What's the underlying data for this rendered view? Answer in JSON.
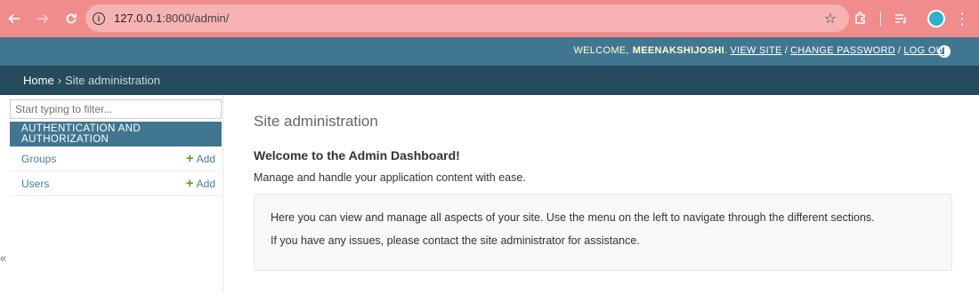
{
  "browser": {
    "url_host": "127.0.0.1",
    "url_rest": ":8000/admin/"
  },
  "header": {
    "welcome": "WELCOME,",
    "username": "MEENAKSHIJOSHI",
    "view_site": "VIEW SITE",
    "change_password": "CHANGE PASSWORD",
    "logout": "LOG OUT",
    "slash": "/"
  },
  "breadcrumbs": {
    "home": "Home",
    "separator": "›",
    "current": "Site administration"
  },
  "sidebar": {
    "filter_placeholder": "Start typing to filter...",
    "module_caption": "AUTHENTICATION AND AUTHORIZATION",
    "models": [
      {
        "name": "Groups",
        "add": "Add"
      },
      {
        "name": "Users",
        "add": "Add"
      }
    ],
    "collapse_symbol": "«"
  },
  "content": {
    "title": "Site administration",
    "welcome_heading": "Welcome to the Admin Dashboard!",
    "welcome_sub": "Manage and handle your application content with ease.",
    "info_line1": "Here you can view and manage all aspects of your site. Use the menu on the left to navigate through the different sections.",
    "info_line2": "If you have any issues, please contact the site administrator for assistance."
  },
  "colors": {
    "browser_bar": "#f08c8c",
    "header_primary": "#417690",
    "breadcrumbs": "#264b5d",
    "link": "#447e9b",
    "add_plus": "#5fa225"
  }
}
